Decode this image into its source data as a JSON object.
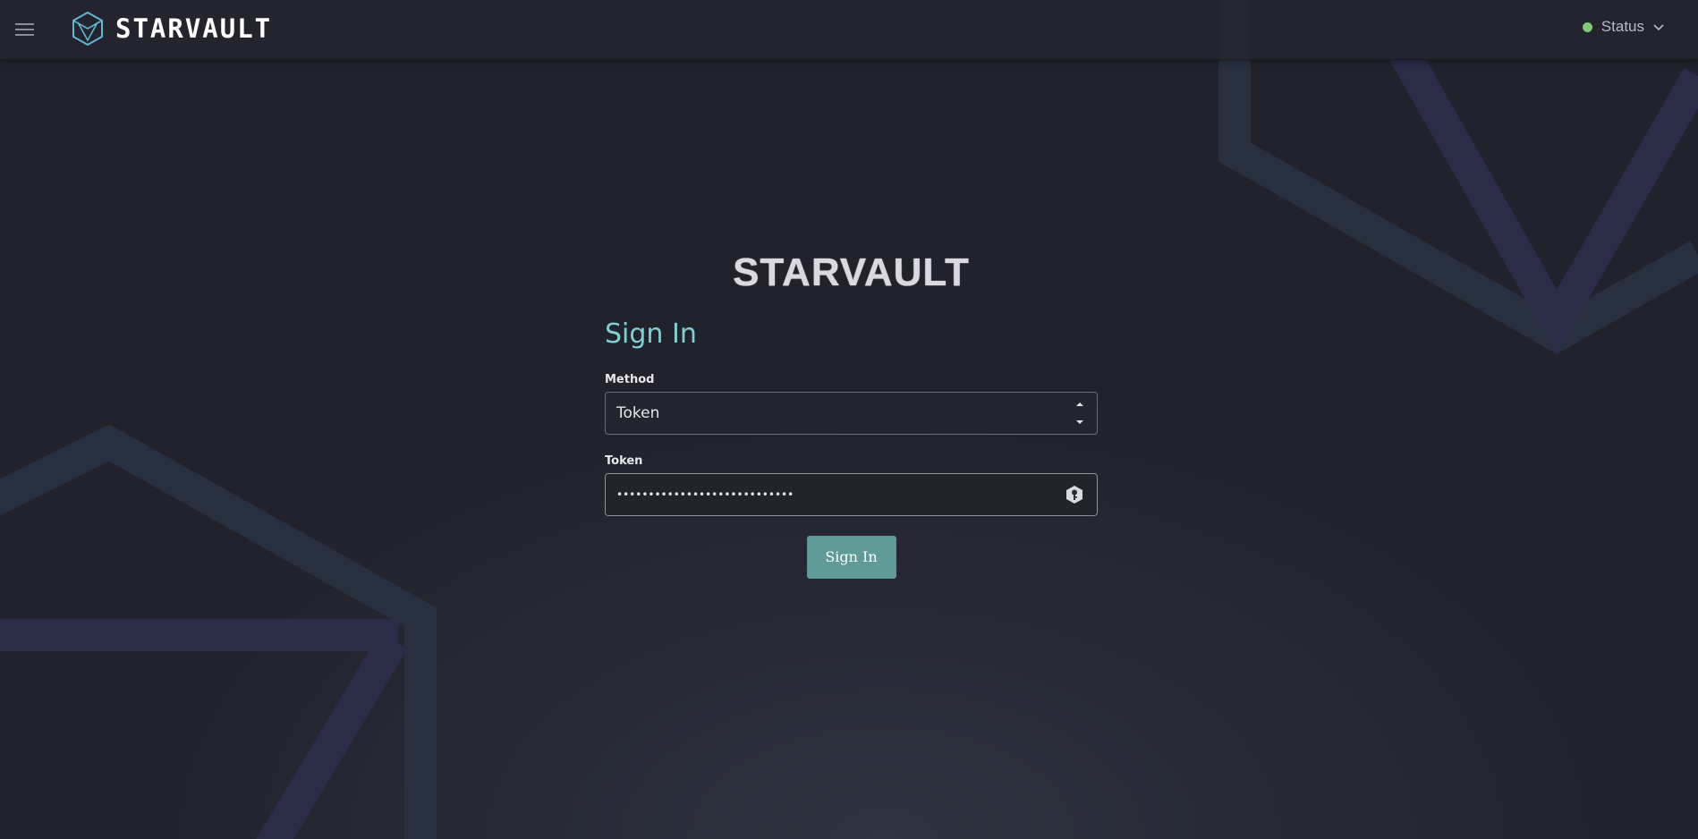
{
  "topbar": {
    "menu_icon": "hamburger-menu-icon",
    "brand_logo_icon": "hexagon-cube-logo-icon",
    "brand_name": "STARVAULT",
    "status_label": "Status",
    "status_color": "#7ecb74",
    "status_chevron_icon": "chevron-down-icon"
  },
  "hero": {
    "logo_text": "STARVAULT"
  },
  "form": {
    "title": "Sign In",
    "method_label": "Method",
    "method_value": "Token",
    "token_label": "Token",
    "token_value": "••••••••••••••••••••••••••••",
    "reveal_icon": "key-hexagon-icon",
    "submit_label": "Sign In"
  },
  "colors": {
    "accent_title": "#7fd0d0",
    "button_bg": "#5f9b97",
    "background": "#23242d"
  }
}
